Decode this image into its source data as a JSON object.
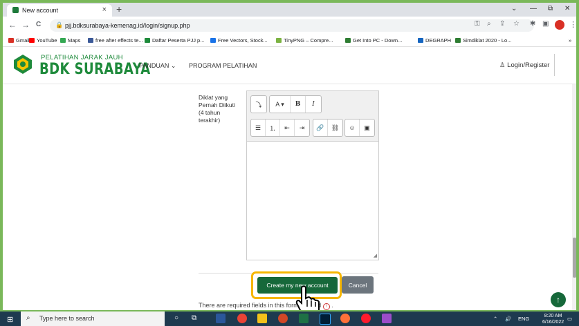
{
  "browser": {
    "tab_title": "New account",
    "tab_close": "×",
    "new_tab": "+",
    "url": "pjj.bdksurabaya-kemenag.id/login/signup.php",
    "back": "←",
    "forward": "→",
    "reload": "C",
    "window_min": "—",
    "window_restore": "⧉",
    "window_close": "✕",
    "collapse": "⌄"
  },
  "bookmarks": [
    {
      "label": "Gmail",
      "color": "#d93025"
    },
    {
      "label": "YouTube",
      "color": "#ff0000"
    },
    {
      "label": "Maps",
      "color": "#34a853"
    },
    {
      "label": "free after effects te...",
      "color": "#3b5998"
    },
    {
      "label": "Daftar Peserta PJJ p...",
      "color": "#1e8a3b"
    },
    {
      "label": "Free Vectors, Stock...",
      "color": "#1a73e8"
    },
    {
      "label": "TinyPNG – Compre...",
      "color": "#7cb342"
    },
    {
      "label": "Get Into PC - Down...",
      "color": "#2e7d32"
    },
    {
      "label": "DEGRAPH",
      "color": "#1565c0"
    },
    {
      "label": "Simdiklat 2020 - Lo...",
      "color": "#2e7d32"
    }
  ],
  "site": {
    "logo_top": "PELATIHAN JARAK JAUH",
    "logo_main": "BDK SURABAYA",
    "nav": [
      "PANDUAN ⌄",
      "PROGRAM PELATIHAN"
    ],
    "login": "Login/Register"
  },
  "form": {
    "field_label": "Diklat yang Pernah Diikuti (4 tahun terakhir)",
    "editor_buttons_row1": [
      "⤵",
      "A ▾",
      "B",
      "I"
    ],
    "editor_buttons_row2": [
      "☰",
      "⒈",
      "⇤",
      "⇥",
      "🔗",
      "⛓",
      "☺",
      "▣"
    ],
    "create_button": "Create my new account",
    "cancel_button": "Cancel",
    "required_note": "There are required fields in this form marked",
    "required_note_end": "."
  },
  "taskbar": {
    "search_placeholder": "Type here to search",
    "lang": "ENG",
    "time": "8:20 AM",
    "date": "6/16/2022"
  },
  "colors": {
    "accent_green": "#16683a",
    "highlight": "#f6b600",
    "brand_green": "#1e8a3b"
  }
}
